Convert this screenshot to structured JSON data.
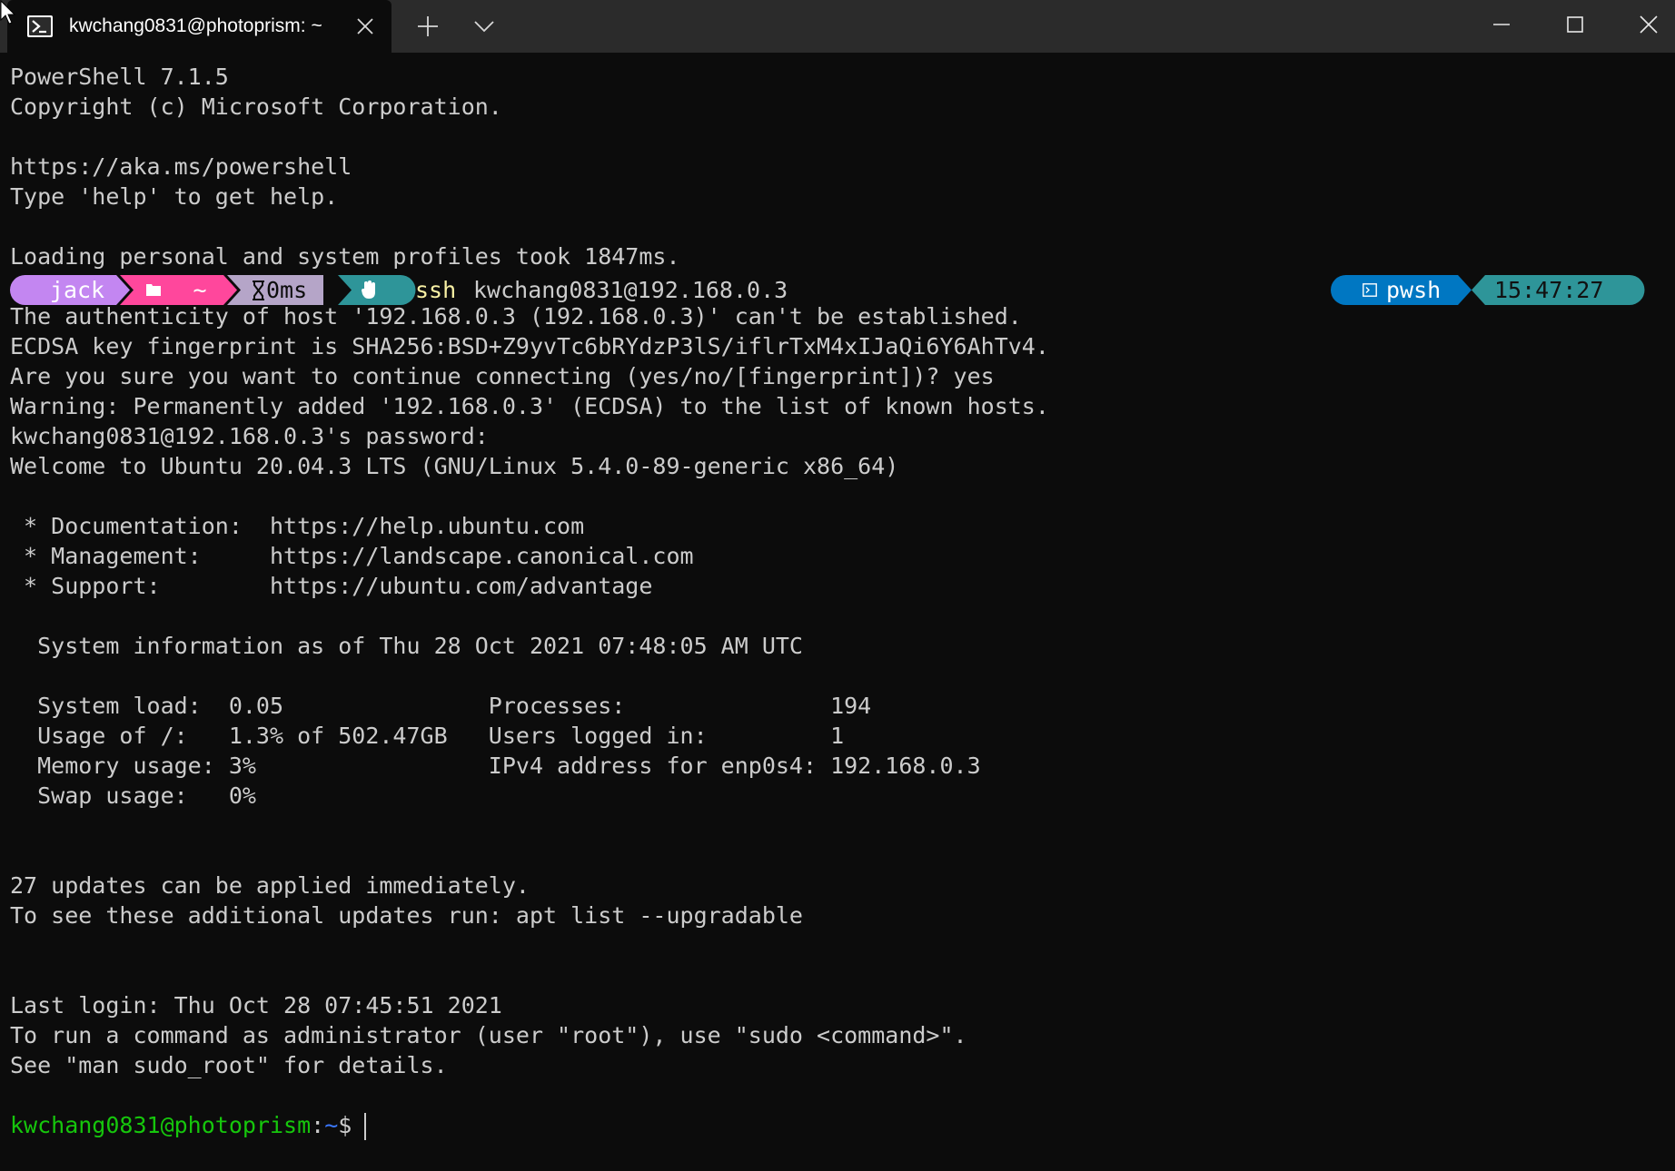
{
  "window": {
    "tab_title": "kwchang0831@photoprism: ~",
    "tab_icon": "powershell-icon",
    "new_tab_icon": "plus-icon",
    "dropdown_icon": "chevron-down-icon",
    "minimize_icon": "minimize-icon",
    "maximize_icon": "maximize-icon",
    "close_icon": "close-icon"
  },
  "colors": {
    "background": "#0c0c0c",
    "titlebar": "#2b2b2b",
    "text": "#cccccc",
    "seg_user": "#c386f1",
    "seg_path": "#ff479c",
    "seg_time": "#b5a5c8",
    "seg_status": "#2e9599",
    "seg_shell": "#0077c2",
    "seg_clock": "#2e9599",
    "command_yellow": "#f9f1a5",
    "bash_user_green": "#16c60c",
    "bash_path_blue": "#3b78ff"
  },
  "terminal": {
    "header_lines": [
      "PowerShell 7.1.5",
      "Copyright (c) Microsoft Corporation.",
      "",
      "https://aka.ms/powershell",
      "Type 'help' to get help.",
      "",
      "Loading personal and system profiles took 1847ms."
    ],
    "prompt": {
      "user": "jack",
      "folder_icon": "folder-icon",
      "path": "~",
      "hourglass_icon": "hourglass-icon",
      "duration": "0ms",
      "status_icon": "hand-icon",
      "command": "ssh",
      "command_args": "kwchang0831@192.168.0.3",
      "shell_icon": "terminal-icon",
      "shell": "pwsh",
      "clock": "15:47:27"
    },
    "output_lines": [
      "The authenticity of host '192.168.0.3 (192.168.0.3)' can't be established.",
      "ECDSA key fingerprint is SHA256:BSD+Z9yvTc6bRYdzP3lS/iflrTxM4xIJaQi6Y6AhTv4.",
      "Are you sure you want to continue connecting (yes/no/[fingerprint])? yes",
      "Warning: Permanently added '192.168.0.3' (ECDSA) to the list of known hosts.",
      "kwchang0831@192.168.0.3's password:",
      "Welcome to Ubuntu 20.04.3 LTS (GNU/Linux 5.4.0-89-generic x86_64)",
      "",
      " * Documentation:  https://help.ubuntu.com",
      " * Management:     https://landscape.canonical.com",
      " * Support:        https://ubuntu.com/advantage",
      "",
      "  System information as of Thu 28 Oct 2021 07:48:05 AM UTC",
      "",
      "  System load:  0.05               Processes:               194",
      "  Usage of /:   1.3% of 502.47GB   Users logged in:         1",
      "  Memory usage: 3%                 IPv4 address for enp0s4: 192.168.0.3",
      "  Swap usage:   0%",
      "",
      "",
      "27 updates can be applied immediately.",
      "To see these additional updates run: apt list --upgradable",
      "",
      "",
      "Last login: Thu Oct 28 07:45:51 2021",
      "To run a command as administrator (user \"root\"), use \"sudo <command>\".",
      "See \"man sudo_root\" for details.",
      ""
    ],
    "bash_prompt": {
      "user_host": "kwchang0831@photoprism",
      "colon": ":",
      "path": "~",
      "symbol": "$"
    }
  }
}
